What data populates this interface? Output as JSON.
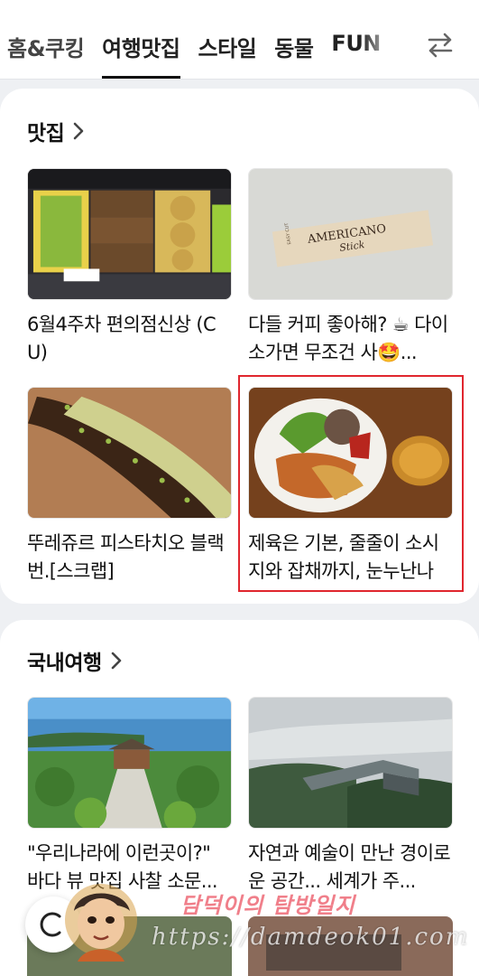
{
  "tabs": [
    {
      "label": "홈&쿠킹",
      "active": false
    },
    {
      "label": "여행맛집",
      "active": true
    },
    {
      "label": "스타일",
      "active": false
    },
    {
      "label": "동물",
      "active": false
    },
    {
      "label": "FUN",
      "active": false
    }
  ],
  "tab_swap_icon": "swap-arrows-icon",
  "sections": [
    {
      "title": "맛집",
      "items": [
        {
          "caption": "6월4주차 편의점신상 (CU)",
          "image": "convenience-store-snacks-shelf"
        },
        {
          "caption": "다들 커피 좋아해? ☕ 다이소가면 무조건 사🤩...",
          "image": "americano-stick-packet",
          "packet_text": [
            "AMERICANO",
            "Stick",
            "EASY CUT"
          ]
        },
        {
          "caption": "뚜레쥬르 피스타치오 블랙번.[스크랩]",
          "image": "pistachio-black-bun"
        },
        {
          "caption": "제육은 기본, 줄줄이 소시지와 잡채까지, 눈누난나",
          "image": "buffet-plate",
          "highlighted": true
        }
      ]
    },
    {
      "title": "국내여행",
      "items": [
        {
          "caption": "\"우리나라에 이런곳이?\" 바다 뷰 맛집 사찰 소문...",
          "image": "seaside-temple-garden"
        },
        {
          "caption": "자연과 예술이 만난 경이로운 공간... 세계가 주...",
          "image": "misty-forest-museum"
        }
      ]
    }
  ],
  "watermark": {
    "title": "담덕이의 탐방일지",
    "url": "https://damdeok01.com"
  },
  "colors": {
    "highlight": "#e0262e",
    "background": "#eef0f3",
    "card": "#ffffff"
  }
}
